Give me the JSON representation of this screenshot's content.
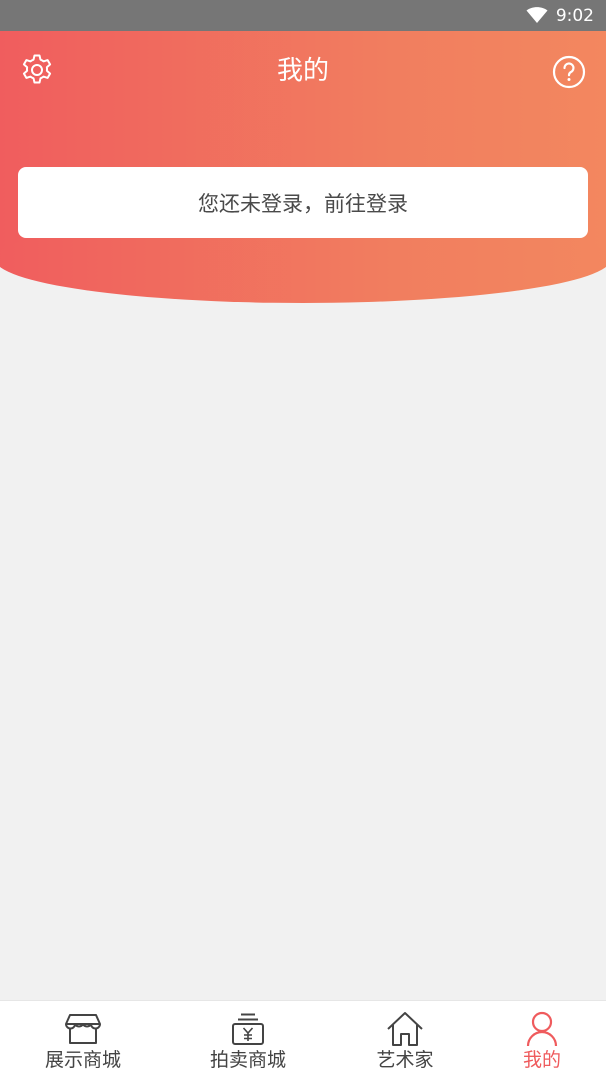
{
  "status_bar": {
    "time": "9:02",
    "wifi_icon": "wifi-icon"
  },
  "header": {
    "title": "我的",
    "settings_icon": "gear-icon",
    "help_icon": "help-circle-icon",
    "gradient_start": "#f05d5e",
    "gradient_end": "#f3875f"
  },
  "login_card": {
    "text": "您还未登录，前往登录"
  },
  "bottom_nav": {
    "active_color": "#ef5b5d",
    "items": [
      {
        "label": "展示商城",
        "icon": "store-icon",
        "active": false
      },
      {
        "label": "拍卖商城",
        "icon": "auction-yen-icon",
        "active": false
      },
      {
        "label": "艺术家",
        "icon": "home-icon",
        "active": false
      },
      {
        "label": "我的",
        "icon": "user-icon",
        "active": true
      }
    ]
  }
}
